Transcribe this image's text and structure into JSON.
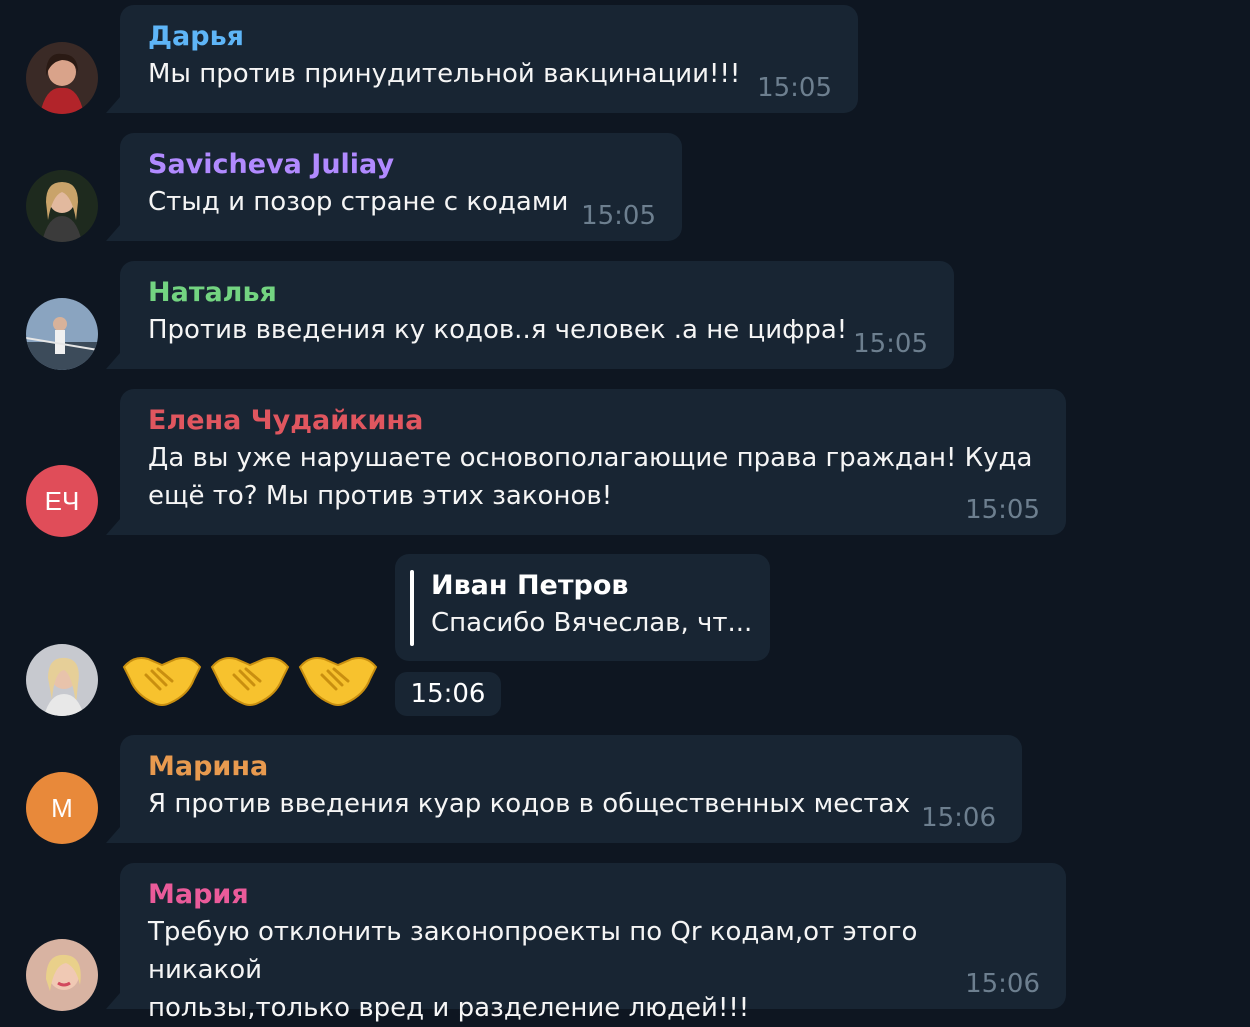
{
  "messages": [
    {
      "sender": "Дарья",
      "color": "#5eb5f7",
      "lines": [
        "Мы против принудительной вакцинации!!!"
      ],
      "time": "15:05"
    },
    {
      "sender": "Savicheva Juliay",
      "color": "#b18aff",
      "lines": [
        "Стыд и позор стране с кодами"
      ],
      "time": "15:05"
    },
    {
      "sender": "Наталья",
      "color": "#73d481",
      "lines": [
        "Против введения ку кодов..я человек .а не цифра!"
      ],
      "time": "15:05"
    },
    {
      "sender": "Елена Чудайкина",
      "color": "#e0565f",
      "initials": "ЕЧ",
      "avatar_color": "#e04d59",
      "lines": [
        "Да вы уже нарушаете основополагающие права граждан! Куда",
        "ещё то? Мы против этих законов!"
      ],
      "time": "15:05"
    },
    {
      "reply": {
        "name": "Иван Петров",
        "text": "Спасибо Вячеслав, чт..."
      },
      "emoji_count": 3,
      "time": "15:06"
    },
    {
      "sender": "Марина",
      "color": "#e89a4f",
      "initials": "М",
      "avatar_color": "#e8893a",
      "lines": [
        "Я против введения куар кодов в общественных местах"
      ],
      "time": "15:06"
    },
    {
      "sender": "Мария",
      "color": "#ea5b9a",
      "lines": [
        "Требую отклонить законопроекты по Qr кодам,от этого никакой",
        "пользы,только вред и разделение людей!!!"
      ],
      "time": "15:06"
    }
  ],
  "icons": {
    "emoji": "handshake-emoji"
  }
}
